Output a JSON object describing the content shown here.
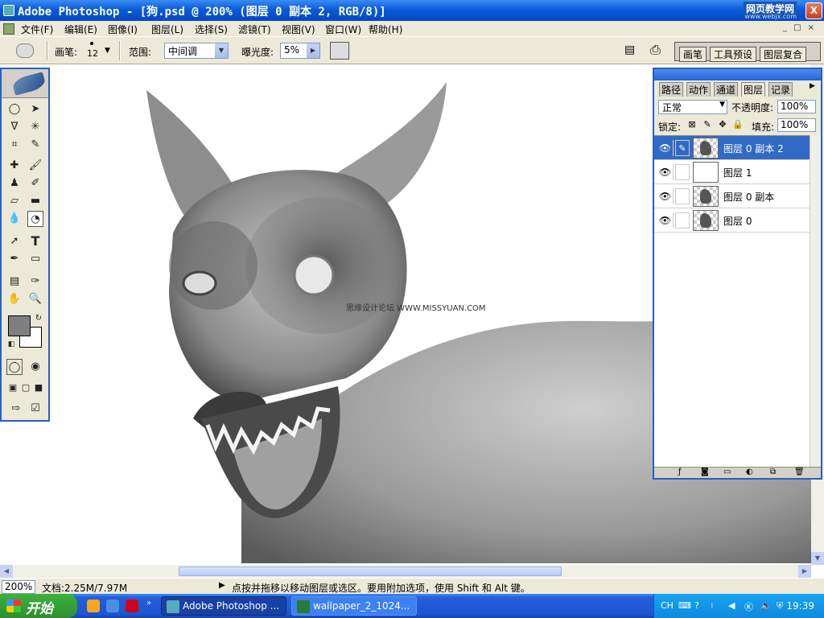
{
  "titlebar": {
    "title": "Adobe Photoshop - [狗.psd @ 200% (图层 0 副本 2, RGB/8)]",
    "watermark": "网页教学网",
    "watermark_sub": "www.webjx.com",
    "minimize": "_",
    "maximize": "□",
    "close": "X"
  },
  "menu": [
    "文件(F)",
    "编辑(E)",
    "图像(I)",
    "图层(L)",
    "选择(S)",
    "滤镜(T)",
    "视图(V)",
    "窗口(W)",
    "帮助(H)"
  ],
  "options": {
    "brush_label": "画笔:",
    "brush_size": "12",
    "range_label": "范围:",
    "range_value": "中间调",
    "exposure_label": "曝光度:",
    "exposure_value": "5%",
    "well_tabs": [
      "画笔",
      "工具预设",
      "图层复合"
    ]
  },
  "canvas": {
    "watermark_text": "思缘设计论坛 WWW.MISSYUAN.COM"
  },
  "layers_panel": {
    "tabs": [
      "路径",
      "动作",
      "通道",
      "图层",
      "记录"
    ],
    "blend_mode": "正常",
    "opacity_label": "不透明度:",
    "opacity_value": "100%",
    "lock_label": "锁定:",
    "fill_label": "填充:",
    "fill_value": "100%",
    "layers": [
      {
        "name": "图层 0 副本 2",
        "selected": true,
        "thumb": "dog"
      },
      {
        "name": "图层 1",
        "selected": false,
        "thumb": "blank"
      },
      {
        "name": "图层 0 副本",
        "selected": false,
        "thumb": "dog"
      },
      {
        "name": "图层 0",
        "selected": false,
        "thumb": "dog"
      }
    ]
  },
  "statusbar": {
    "zoom": "200%",
    "doc_info": "文档:2.25M/7.97M",
    "message": "点按并拖移以移动图层或选区。要用附加选项，使用 Shift 和 Alt 键。"
  },
  "taskbar": {
    "start": "开始",
    "tasks": [
      "Adobe Photoshop ...",
      "wallpaper_2_1024..."
    ],
    "tray_lang": "CH",
    "clock": "19:39"
  },
  "colors": {
    "titlebar": "#0a5bd8",
    "selected_layer": "#316ac5",
    "chrome": "#ece9d8"
  }
}
